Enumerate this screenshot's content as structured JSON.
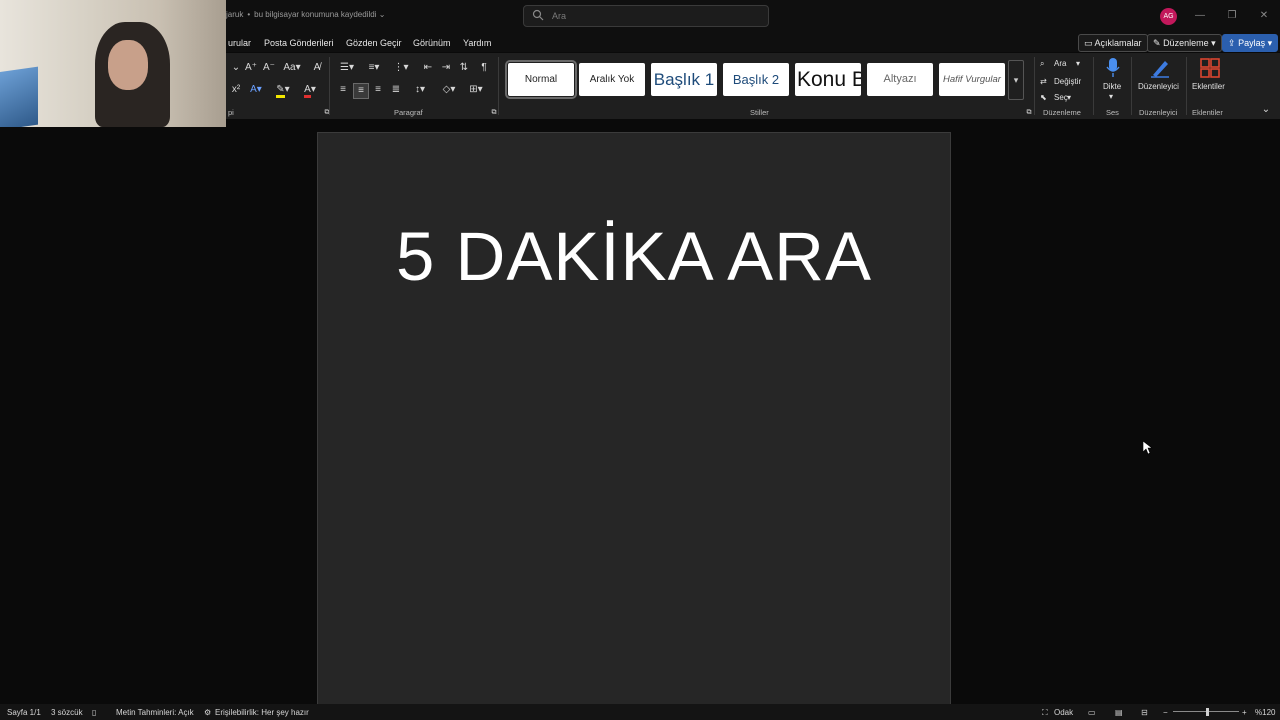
{
  "titlebar": {
    "doc_name": "jaruk",
    "save_status": "bu bilgisayar konumuna kaydedildi",
    "search_placeholder": "Ara",
    "avatar_initials": "AG"
  },
  "menu": {
    "items": [
      "urular",
      "Posta Gönderileri",
      "Gözden Geçir",
      "Görünüm",
      "Yardım"
    ]
  },
  "top_buttons": {
    "comments": "Açıklamalar",
    "editing": "Düzenleme",
    "share": "Paylaş"
  },
  "ribbon": {
    "font_group_label": "pi",
    "paragraph_label": "Paragraf",
    "styles_label": "Stiller",
    "styles": [
      "Normal",
      "Aralık Yok",
      "Başlık 1",
      "Başlık 2",
      "Konu B",
      "Altyazı",
      "Hafif Vurgular"
    ],
    "selected_style": "Normal",
    "editing_group": {
      "find": "Ara",
      "replace": "Değiştir",
      "select": "Seç",
      "label": "Düzenleme"
    },
    "voice": {
      "dictate": "Dikte",
      "label": "Ses"
    },
    "editor": {
      "button": "Düzenleyici",
      "label": "Düzenleyici"
    },
    "addins": {
      "button": "Eklentiler",
      "label": "Eklentiler"
    }
  },
  "document": {
    "heading": "5 DAKİKA ARA"
  },
  "statusbar": {
    "page": "Sayfa 1/1",
    "words": "3 sözcük",
    "predictions": "Metin Tahminleri: Açık",
    "accessibility": "Erişilebilirlik: Her şey hazır",
    "focus": "Odak",
    "zoom": "%120"
  },
  "colors": {
    "accent": "#2b5fae",
    "avatar": "#c2185b",
    "page": "#262626",
    "ribbon": "#1f1f1f"
  }
}
